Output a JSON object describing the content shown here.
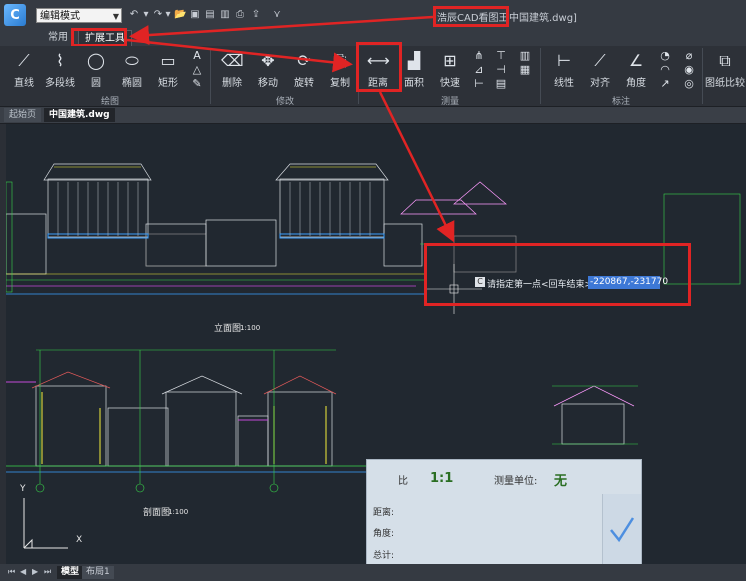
{
  "titlebar": {
    "mode": "编辑模式",
    "app_title": "浩辰CAD看图王",
    "doc_title": "中国建筑.dwg]"
  },
  "ribbon_tabs": [
    "常用",
    "扩展工具"
  ],
  "tools": {
    "line": "直线",
    "polyline": "多段线",
    "circle": "圆",
    "ellipse": "椭圆",
    "rect": "矩形",
    "delete": "删除",
    "move": "移动",
    "rotate": "旋转",
    "copy": "复制",
    "distance": "距离",
    "area": "面积",
    "quick": "快速",
    "linear": "线性",
    "align": "对齐",
    "angle": "角度",
    "compare": "图纸比较"
  },
  "groups": {
    "draw": "绘图",
    "modify": "修改",
    "measure": "测量",
    "annotate": "标注"
  },
  "doc_tabs": [
    "起始页",
    "中国建筑.dwg"
  ],
  "prompt": {
    "icon": "C",
    "text": "请指定第一点<回车结束>:",
    "value": "-220867,-231770"
  },
  "measure_panel": {
    "ratio_label": "比",
    "ratio_value": "1:1",
    "unit_label": "测量单位:",
    "unit_value": "无",
    "distance_label": "距离:",
    "angle_label": "角度:",
    "total_label": "总计:"
  },
  "drawing_labels": {
    "elevation": "立面图",
    "elevation_scale": "1:100",
    "section": "剖面图",
    "section_scale": "1:100"
  },
  "ucs": {
    "y": "Y",
    "x": "X"
  },
  "bottom_tabs": [
    "模型",
    "布局1"
  ],
  "colors": {
    "annotation_red": "#e02424",
    "selection_blue": "#3d78d6",
    "canvas": "#212830"
  }
}
